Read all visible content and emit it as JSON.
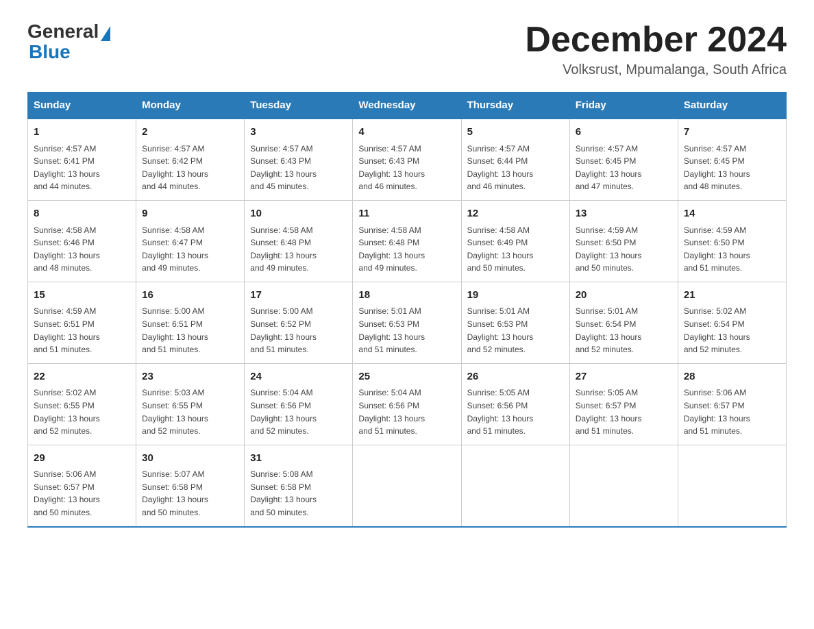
{
  "header": {
    "logo_general": "General",
    "logo_blue": "Blue",
    "month_title": "December 2024",
    "subtitle": "Volksrust, Mpumalanga, South Africa"
  },
  "days_of_week": [
    "Sunday",
    "Monday",
    "Tuesday",
    "Wednesday",
    "Thursday",
    "Friday",
    "Saturday"
  ],
  "weeks": [
    [
      {
        "day": "1",
        "sunrise": "4:57 AM",
        "sunset": "6:41 PM",
        "daylight": "13 hours and 44 minutes."
      },
      {
        "day": "2",
        "sunrise": "4:57 AM",
        "sunset": "6:42 PM",
        "daylight": "13 hours and 44 minutes."
      },
      {
        "day": "3",
        "sunrise": "4:57 AM",
        "sunset": "6:43 PM",
        "daylight": "13 hours and 45 minutes."
      },
      {
        "day": "4",
        "sunrise": "4:57 AM",
        "sunset": "6:43 PM",
        "daylight": "13 hours and 46 minutes."
      },
      {
        "day": "5",
        "sunrise": "4:57 AM",
        "sunset": "6:44 PM",
        "daylight": "13 hours and 46 minutes."
      },
      {
        "day": "6",
        "sunrise": "4:57 AM",
        "sunset": "6:45 PM",
        "daylight": "13 hours and 47 minutes."
      },
      {
        "day": "7",
        "sunrise": "4:57 AM",
        "sunset": "6:45 PM",
        "daylight": "13 hours and 48 minutes."
      }
    ],
    [
      {
        "day": "8",
        "sunrise": "4:58 AM",
        "sunset": "6:46 PM",
        "daylight": "13 hours and 48 minutes."
      },
      {
        "day": "9",
        "sunrise": "4:58 AM",
        "sunset": "6:47 PM",
        "daylight": "13 hours and 49 minutes."
      },
      {
        "day": "10",
        "sunrise": "4:58 AM",
        "sunset": "6:48 PM",
        "daylight": "13 hours and 49 minutes."
      },
      {
        "day": "11",
        "sunrise": "4:58 AM",
        "sunset": "6:48 PM",
        "daylight": "13 hours and 49 minutes."
      },
      {
        "day": "12",
        "sunrise": "4:58 AM",
        "sunset": "6:49 PM",
        "daylight": "13 hours and 50 minutes."
      },
      {
        "day": "13",
        "sunrise": "4:59 AM",
        "sunset": "6:50 PM",
        "daylight": "13 hours and 50 minutes."
      },
      {
        "day": "14",
        "sunrise": "4:59 AM",
        "sunset": "6:50 PM",
        "daylight": "13 hours and 51 minutes."
      }
    ],
    [
      {
        "day": "15",
        "sunrise": "4:59 AM",
        "sunset": "6:51 PM",
        "daylight": "13 hours and 51 minutes."
      },
      {
        "day": "16",
        "sunrise": "5:00 AM",
        "sunset": "6:51 PM",
        "daylight": "13 hours and 51 minutes."
      },
      {
        "day": "17",
        "sunrise": "5:00 AM",
        "sunset": "6:52 PM",
        "daylight": "13 hours and 51 minutes."
      },
      {
        "day": "18",
        "sunrise": "5:01 AM",
        "sunset": "6:53 PM",
        "daylight": "13 hours and 51 minutes."
      },
      {
        "day": "19",
        "sunrise": "5:01 AM",
        "sunset": "6:53 PM",
        "daylight": "13 hours and 52 minutes."
      },
      {
        "day": "20",
        "sunrise": "5:01 AM",
        "sunset": "6:54 PM",
        "daylight": "13 hours and 52 minutes."
      },
      {
        "day": "21",
        "sunrise": "5:02 AM",
        "sunset": "6:54 PM",
        "daylight": "13 hours and 52 minutes."
      }
    ],
    [
      {
        "day": "22",
        "sunrise": "5:02 AM",
        "sunset": "6:55 PM",
        "daylight": "13 hours and 52 minutes."
      },
      {
        "day": "23",
        "sunrise": "5:03 AM",
        "sunset": "6:55 PM",
        "daylight": "13 hours and 52 minutes."
      },
      {
        "day": "24",
        "sunrise": "5:04 AM",
        "sunset": "6:56 PM",
        "daylight": "13 hours and 52 minutes."
      },
      {
        "day": "25",
        "sunrise": "5:04 AM",
        "sunset": "6:56 PM",
        "daylight": "13 hours and 51 minutes."
      },
      {
        "day": "26",
        "sunrise": "5:05 AM",
        "sunset": "6:56 PM",
        "daylight": "13 hours and 51 minutes."
      },
      {
        "day": "27",
        "sunrise": "5:05 AM",
        "sunset": "6:57 PM",
        "daylight": "13 hours and 51 minutes."
      },
      {
        "day": "28",
        "sunrise": "5:06 AM",
        "sunset": "6:57 PM",
        "daylight": "13 hours and 51 minutes."
      }
    ],
    [
      {
        "day": "29",
        "sunrise": "5:06 AM",
        "sunset": "6:57 PM",
        "daylight": "13 hours and 50 minutes."
      },
      {
        "day": "30",
        "sunrise": "5:07 AM",
        "sunset": "6:58 PM",
        "daylight": "13 hours and 50 minutes."
      },
      {
        "day": "31",
        "sunrise": "5:08 AM",
        "sunset": "6:58 PM",
        "daylight": "13 hours and 50 minutes."
      },
      null,
      null,
      null,
      null
    ]
  ],
  "labels": {
    "sunrise": "Sunrise:",
    "sunset": "Sunset:",
    "daylight": "Daylight: "
  }
}
